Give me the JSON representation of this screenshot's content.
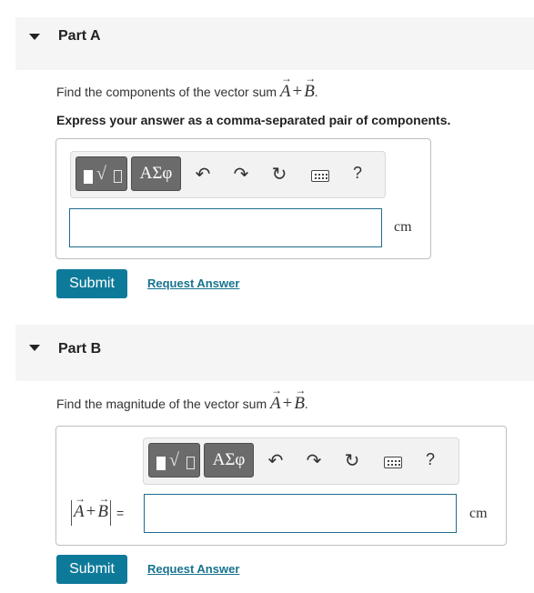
{
  "part_a": {
    "title": "Part A",
    "question_prefix": "Find the components of the vector sum",
    "sum_a": "A",
    "sum_plus": "+",
    "sum_b": "B",
    "sum_period": ".",
    "instruction": "Express your answer as a comma-separated pair of components.",
    "input_value": "",
    "unit": "cm",
    "submit_label": "Submit",
    "request_label": "Request Answer"
  },
  "part_b": {
    "title": "Part B",
    "question_prefix": "Find the magnitude of the vector sum",
    "sum_a": "A",
    "sum_plus": "+",
    "sum_b": "B",
    "sum_period": ".",
    "label_a": "A",
    "label_plus": "+",
    "label_b": "B",
    "label_eq": "=",
    "input_value": "",
    "unit": "cm",
    "submit_label": "Submit",
    "request_label": "Request Answer"
  },
  "toolbar": {
    "greek_label": "ΑΣφ",
    "help_label": "?",
    "icons": [
      "templates-icon",
      "greek-symbols-icon",
      "undo-icon",
      "redo-icon",
      "reset-icon",
      "keyboard-icon",
      "help-icon"
    ]
  },
  "colors": {
    "submit_bg": "#0e7a99",
    "link": "#17738f",
    "input_border": "#1f6d8d",
    "header_bg": "#f5f5f5",
    "toolbar_button": "#6b6b6b"
  }
}
